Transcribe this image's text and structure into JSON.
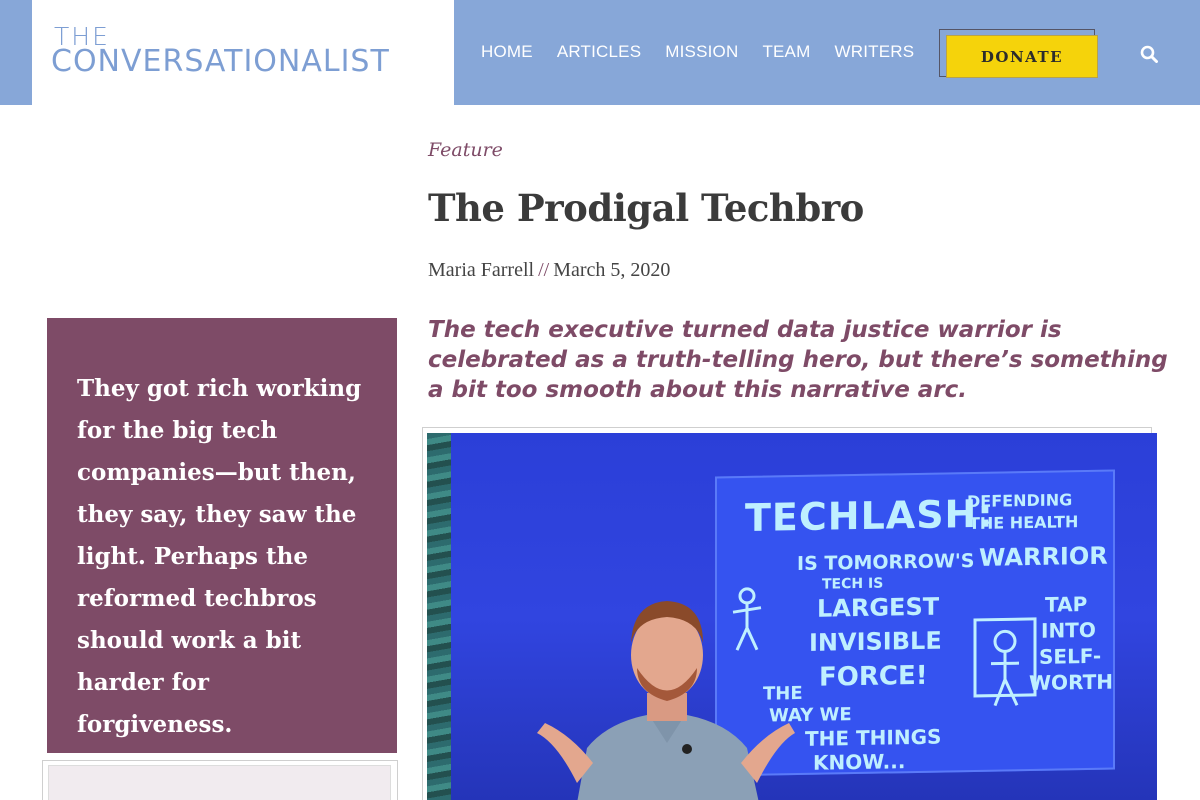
{
  "header": {
    "logo_line1": "THE",
    "logo_line2": "CONVERSATIONALIST",
    "nav": [
      "HOME",
      "ARTICLES",
      "MISSION",
      "TEAM",
      "WRITERS"
    ],
    "donate_label": "DONATE",
    "search_icon": "search-icon"
  },
  "article": {
    "kicker": "Feature",
    "title": "The Prodigal Techbro",
    "author": "Maria Farrell",
    "separator": "//",
    "date": "March 5, 2020",
    "dek": "The tech executive turned data justice warrior is celebrated as a truth-telling hero, but there’s something a bit too smooth about this narrative arc."
  },
  "pullquote": "They got rich working for the big tech companies—but then, they say, they saw the light. Perhaps the reformed techbros should work a bit harder for forgiveness.",
  "hero_board": {
    "line1": "TECHLASH:",
    "line1b": "DEFENDING",
    "line1c": "THE HEALTH",
    "line2": "IS TOMORROW'S",
    "line2b": "WARRIOR",
    "line3": "TECH IS",
    "line4": "LARGEST",
    "line5": "INVISIBLE",
    "line6": "FORCE!",
    "line7": "TAP",
    "line8": "INTO",
    "line9": "SELF-",
    "line10": "WORTH",
    "line11": "THE",
    "line12": "WAY WE",
    "line13": "THE THINGS",
    "line14": "KNOW..."
  },
  "colors": {
    "header_bg": "#87a7d8",
    "accent": "#7e4b67",
    "donate_bg": "#f5d30b"
  }
}
